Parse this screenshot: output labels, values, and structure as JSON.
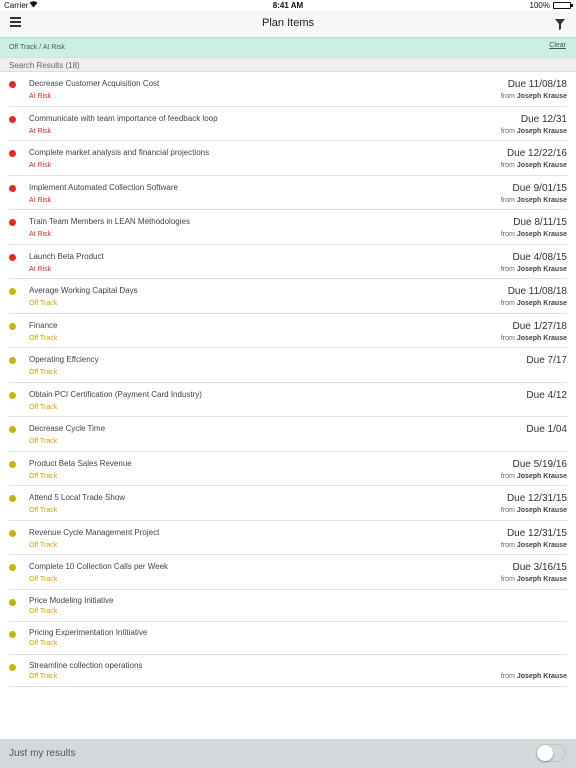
{
  "status_bar": {
    "carrier": "Carrier",
    "time": "8:41 AM",
    "battery": "100%"
  },
  "nav": {
    "title": "Plan Items"
  },
  "filter_bar": {
    "label": "Off Track / At Risk",
    "clear": "Clear"
  },
  "results": {
    "label": "Search Results (18)"
  },
  "colors": {
    "at_risk": "#e8281c",
    "off_track": "#c9b40a",
    "at_risk_text": "#e8281c",
    "off_track_text": "#d4a400"
  },
  "items": [
    {
      "name": "Decrease Customer Acquisition Cost",
      "status": "At Risk",
      "level": "risk",
      "due": "Due 11/08/18",
      "from": "from",
      "owner": "Joseph Krause"
    },
    {
      "name": "Communicate with team importance of feedback loop",
      "status": "At Risk",
      "level": "risk",
      "due": "Due 12/31",
      "from": "from",
      "owner": "Joseph Krause"
    },
    {
      "name": "Complete market analysis and financial projections",
      "status": "At Risk",
      "level": "risk",
      "due": "Due 12/22/16",
      "from": "from",
      "owner": "Joseph Krause"
    },
    {
      "name": "Implement Automated Collection Software",
      "status": "At Risk",
      "level": "risk",
      "due": "Due 9/01/15",
      "from": "from",
      "owner": "Joseph Krause"
    },
    {
      "name": "Train Team Members in LEAN Methodologies",
      "status": "At Risk",
      "level": "risk",
      "due": "Due 8/11/15",
      "from": "from",
      "owner": "Joseph Krause"
    },
    {
      "name": "Launch Beta Product",
      "status": "At Risk",
      "level": "risk",
      "due": "Due 4/08/15",
      "from": "from",
      "owner": "Joseph Krause"
    },
    {
      "name": "Average Working Capital Days",
      "status": "Off Track",
      "level": "off",
      "due": "Due 11/08/18",
      "from": "from",
      "owner": "Joseph Krause"
    },
    {
      "name": "Finance",
      "status": "Off Track",
      "level": "off",
      "due": "Due 1/27/18",
      "from": "from",
      "owner": "Joseph Krause"
    },
    {
      "name": "Operating Effciency",
      "status": "Off Track",
      "level": "off",
      "due": "Due 7/17",
      "from": "",
      "owner": ""
    },
    {
      "name": "Obtain PCI Certification (Payment Card Industry)",
      "status": "Off Track",
      "level": "off",
      "due": "Due 4/12",
      "from": "",
      "owner": ""
    },
    {
      "name": "Decrease Cycle Time",
      "status": "Off Track",
      "level": "off",
      "due": "Due 1/04",
      "from": "",
      "owner": ""
    },
    {
      "name": "Product Beta Sales Revenue",
      "status": "Off Track",
      "level": "off",
      "due": "Due 5/19/16",
      "from": "from",
      "owner": "Joseph Krause"
    },
    {
      "name": "Attend 5 Local Trade Show",
      "status": "Off Track",
      "level": "off",
      "due": "Due 12/31/15",
      "from": "from",
      "owner": "Joseph Krause"
    },
    {
      "name": "Revenue Cycle Management Project",
      "status": "Off Track",
      "level": "off",
      "due": "Due 12/31/15",
      "from": "from",
      "owner": "Joseph Krause"
    },
    {
      "name": "Complete 10 Collection Calls per Week",
      "status": "Off Track",
      "level": "off",
      "due": "Due 3/16/15",
      "from": "from",
      "owner": "Joseph Krause"
    },
    {
      "name": "Price Modeling Initiative",
      "status": "Off Track",
      "level": "off",
      "due": "",
      "from": "",
      "owner": ""
    },
    {
      "name": "Pricing Experimentation Intitiative",
      "status": "Off Track",
      "level": "off",
      "due": "",
      "from": "",
      "owner": ""
    },
    {
      "name": "Streamline collection operations",
      "status": "Off Track",
      "level": "off",
      "due": "",
      "from": "from",
      "owner": "Joseph Krause"
    }
  ],
  "footer": {
    "label": "Just my results",
    "toggle_on": false
  }
}
